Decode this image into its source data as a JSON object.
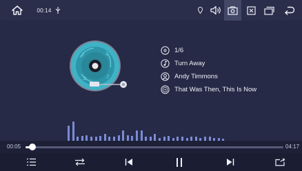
{
  "status_bar": {
    "time": "00:14",
    "icons": [
      "home-icon",
      "usb-icon",
      "location-icon",
      "volume-icon",
      "screenshot-icon",
      "close-box-icon",
      "windows-icon",
      "back-icon"
    ]
  },
  "track_info": {
    "index": "1/6",
    "title": "Turn Away",
    "artist": "Andy Timmons",
    "album": "That Was Then, This Is Now"
  },
  "progress": {
    "elapsed": "00:05",
    "total": "04:17",
    "fraction": 0.02
  },
  "spectrum": {
    "levels": [
      0.8,
      1.0,
      0.2,
      0.25,
      0.3,
      0.2,
      0.2,
      0.25,
      0.35,
      0.2,
      0.2,
      0.3,
      0.55,
      0.3,
      0.25,
      0.55,
      0.55,
      0.2,
      0.2,
      0.35,
      0.15,
      0.2,
      0.25,
      0.15,
      0.2,
      0.2,
      0.15,
      0.2,
      0.2,
      0.15,
      0.2,
      0.2,
      0.15,
      0.15,
      0.1
    ]
  },
  "controls": [
    "playlist-icon",
    "repeat-icon",
    "previous-icon",
    "pause-icon",
    "next-icon",
    "share-icon"
  ],
  "colors": {
    "accent": "#7b8bd6",
    "disc": "#3fb2c6"
  }
}
